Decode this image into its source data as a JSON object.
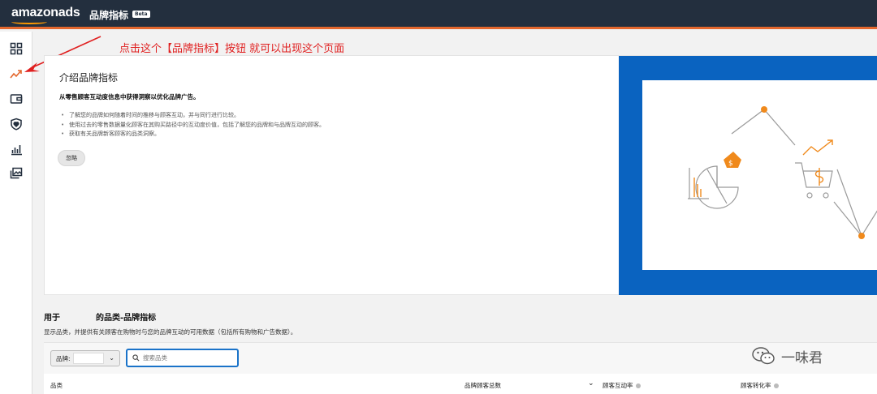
{
  "header": {
    "logo": "amazonads",
    "product_title": "品牌指标",
    "beta": "Beta"
  },
  "sidebar": {
    "icons": [
      "dashboard-icon",
      "trend-icon",
      "wallet-icon",
      "shield-heart-icon",
      "bar-chart-icon",
      "media-library-icon"
    ]
  },
  "annotation": {
    "text": "点击这个【品牌指标】按钮  就可以出现这个页面",
    "color": "#e02020"
  },
  "intro": {
    "title": "介绍品牌指标",
    "subtitle": "从零售顾客互动度信息中获得洞察以优化品牌广告。",
    "bullets": [
      "了解您的品牌如何随着时间的推移与顾客互动，并与同行进行比较。",
      "使用过去的零售数据量化顾客在其购买路径中的互动度价值，包括了解您的品牌和与品牌互动的顾客。",
      "获取有关品牌新客顾客的品类洞察。"
    ],
    "dismiss_label": "忽略"
  },
  "section": {
    "title_prefix": "用于",
    "title_suffix": "的品类-品牌指标",
    "description": "显示品类，并提供有关顾客在购物时与您的品牌互动的可用数据（包括所有购物和广告数据）。"
  },
  "filters": {
    "brand_label": "品牌:",
    "search_placeholder": "搜索品类"
  },
  "table": {
    "columns": [
      "品类",
      "品牌顾客总数",
      "顾客互动率",
      "顾客转化率"
    ]
  },
  "watermark": {
    "text": "一味君"
  },
  "colors": {
    "topbar": "#232f3e",
    "accent": "#e3672d",
    "illustration_blue": "#0a63c0",
    "illustration_orange": "#f08a1c"
  }
}
